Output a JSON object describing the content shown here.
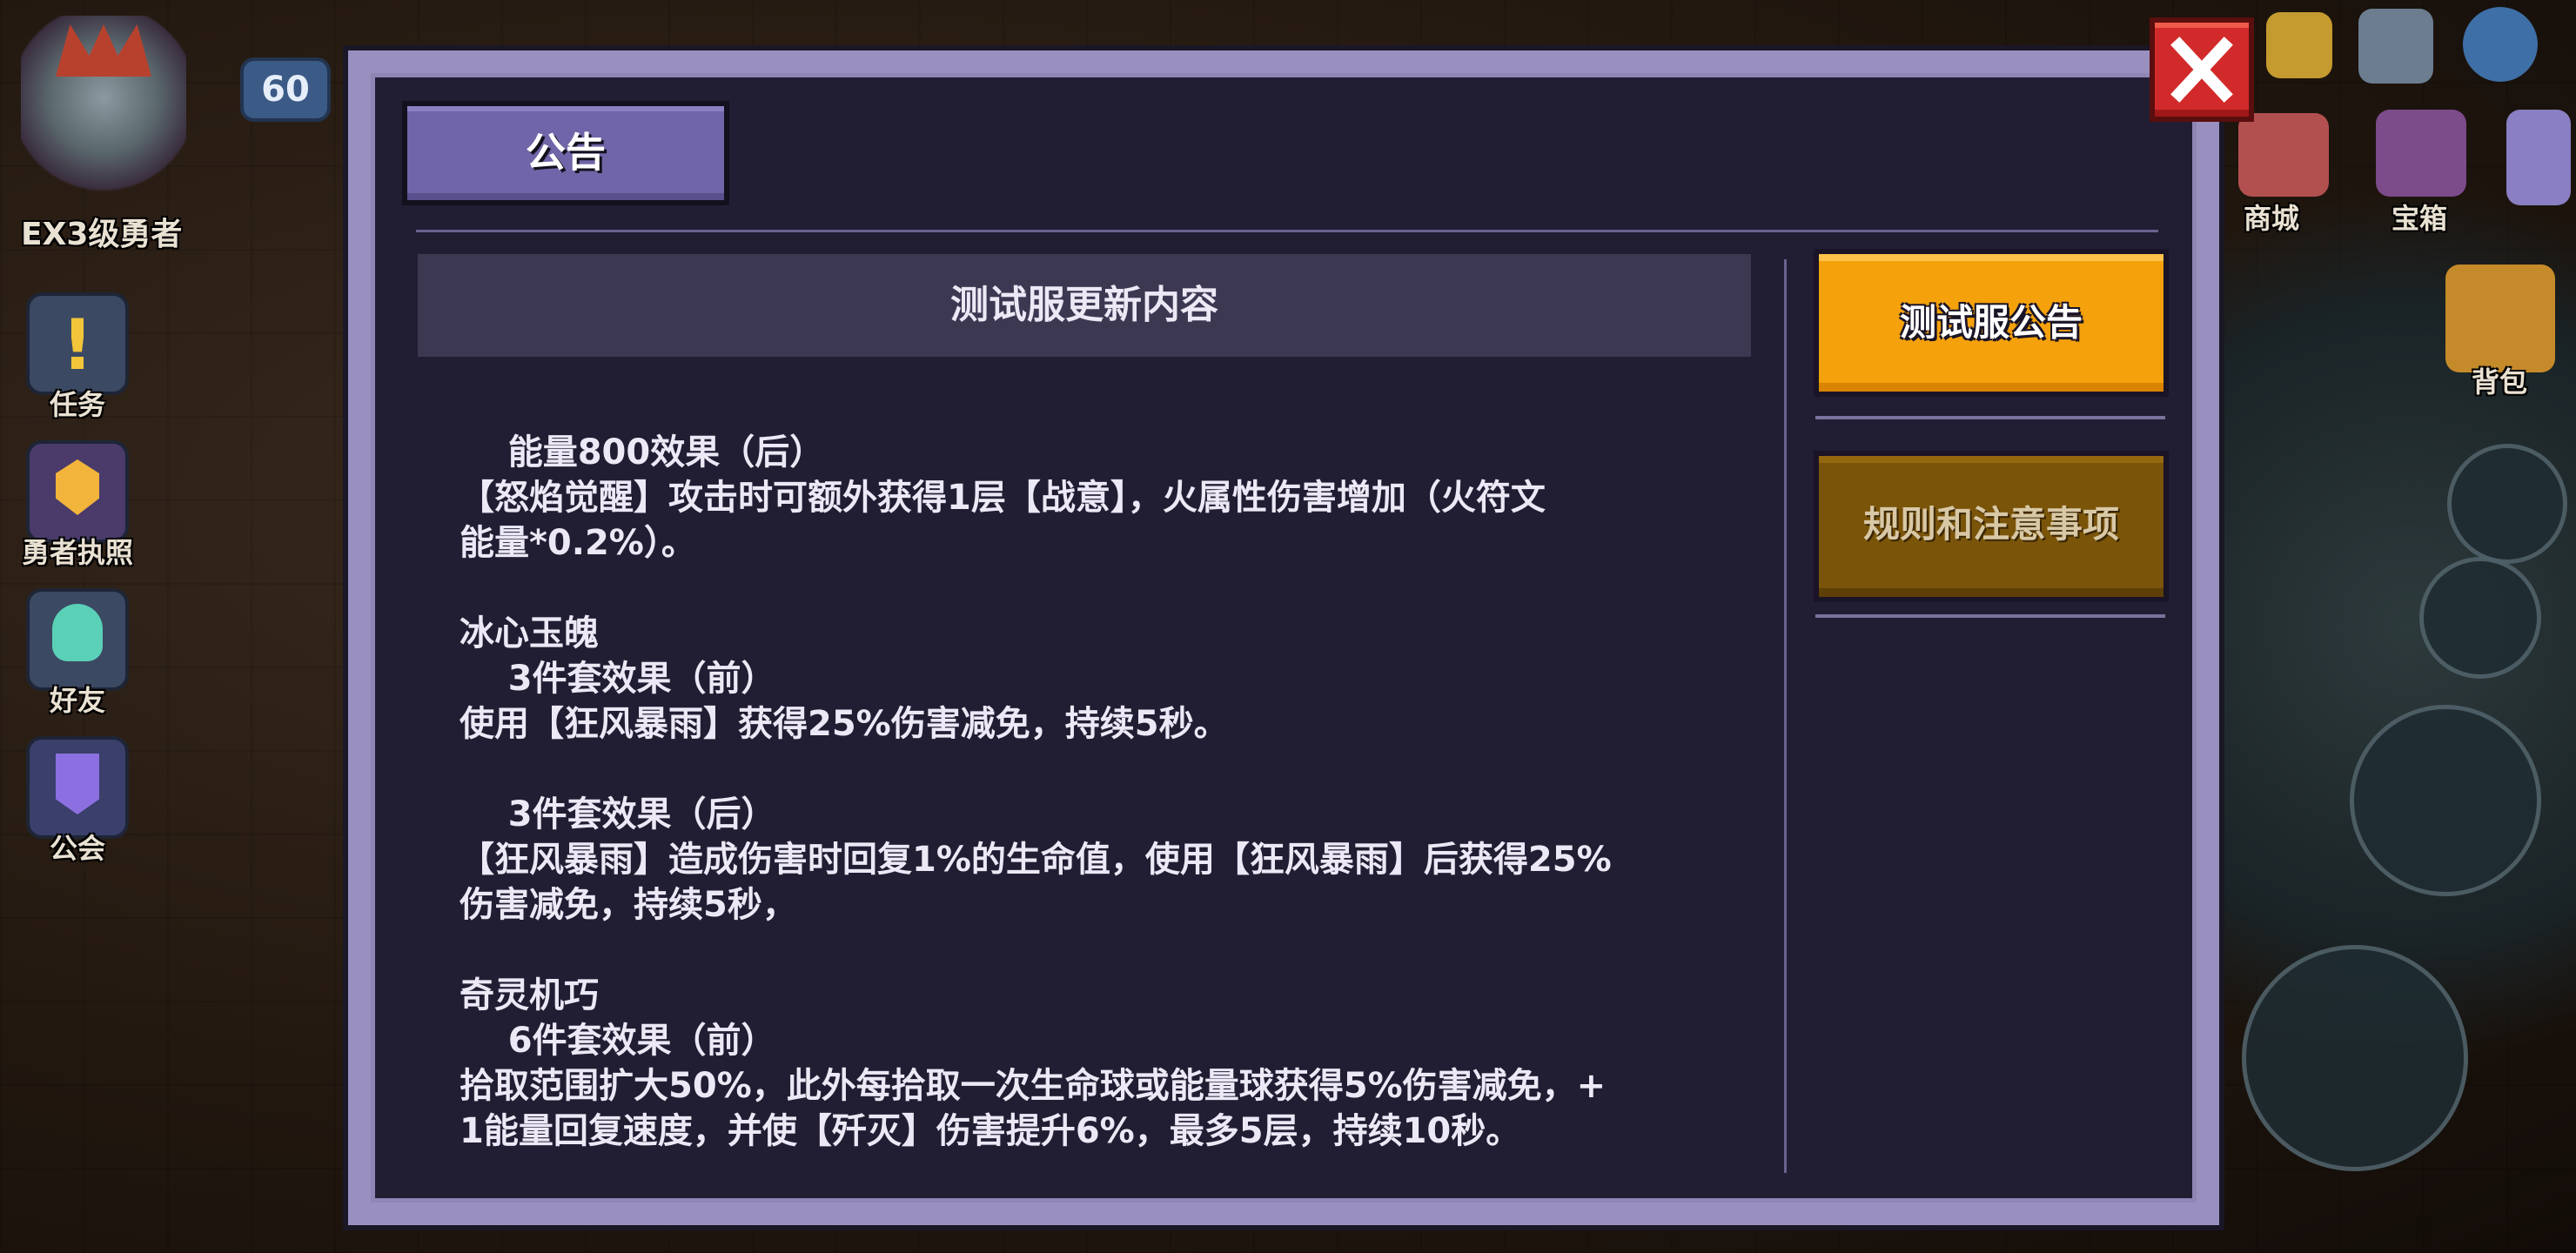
{
  "hud": {
    "level": "60",
    "hero_rank": "EX3级勇者",
    "side_buttons": [
      "任务",
      "勇者执照",
      "好友",
      "公会"
    ],
    "shop_label": "商城",
    "chest_label": "宝箱",
    "bag_label": "背包"
  },
  "modal": {
    "tab_title": "公告",
    "content_title": "测试服更新内容",
    "lines": [
      "    能量800效果（后）",
      "【怒焰觉醒】攻击时可额外获得1层【战意】，火属性伤害增加（火符文",
      "能量*0.2%）。",
      "",
      "冰心玉魄",
      "    3件套效果（前）",
      "使用【狂风暴雨】获得25%伤害减免，持续5秒。",
      "",
      "    3件套效果（后）",
      "【狂风暴雨】造成伤害时回复1%的生命值，使用【狂风暴雨】后获得25%",
      "伤害减免，持续5秒，",
      "",
      "奇灵机巧",
      "    6件套效果（前）",
      "拾取范围扩大50%，此外每拾取一次生命球或能量球获得5%伤害减免，+",
      "1能量回复速度，并使【歼灭】伤害提升6%，最多5层，持续10秒。"
    ],
    "side_tabs": [
      {
        "label": "测试服公告",
        "active": true
      },
      {
        "label": "规则和注意事项",
        "active": false
      }
    ]
  },
  "colors": {
    "active_tab": "#f5a10b",
    "inactive_tab": "#7a5409",
    "announce_tab": "#6f65a8",
    "close_button": "#d22a2a"
  }
}
